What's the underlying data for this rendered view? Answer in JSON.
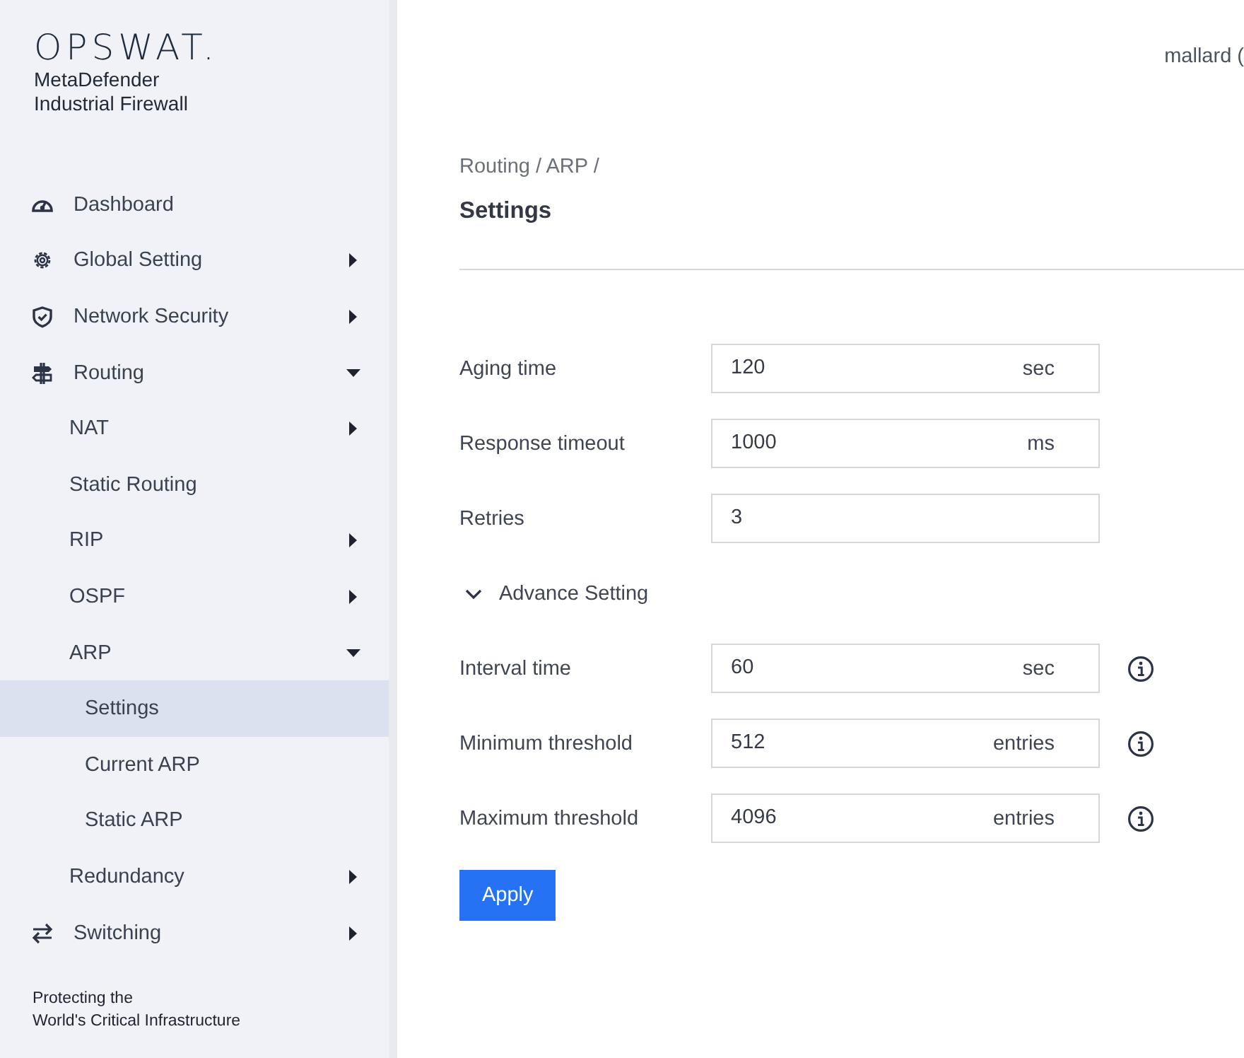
{
  "sidebar": {
    "logo": "OPSWAT.",
    "product_lines": [
      "MetaDefender",
      "Industrial Firewall"
    ],
    "nav": [
      {
        "label": "Dashboard",
        "kind": "dashboard",
        "expandable": false,
        "expanded": false,
        "selected": false
      },
      {
        "label": "Global Setting",
        "kind": "gear",
        "expandable": true,
        "expanded": false,
        "selected": false
      },
      {
        "label": "Network Security",
        "kind": "shield",
        "expandable": true,
        "expanded": false,
        "selected": false
      },
      {
        "label": "Routing",
        "kind": "signpost",
        "expandable": true,
        "expanded": true,
        "selected": false,
        "children": [
          {
            "label": "NAT",
            "expandable": true,
            "expanded": false,
            "selected": false
          },
          {
            "label": "Static Routing",
            "expandable": false,
            "expanded": false,
            "selected": false
          },
          {
            "label": "RIP",
            "expandable": true,
            "expanded": false,
            "selected": false
          },
          {
            "label": "OSPF",
            "expandable": true,
            "expanded": false,
            "selected": false
          },
          {
            "label": "ARP",
            "expandable": true,
            "expanded": true,
            "selected": false,
            "children": [
              {
                "label": "Settings",
                "expandable": false,
                "expanded": false,
                "selected": true
              },
              {
                "label": "Current ARP",
                "expandable": false,
                "expanded": false,
                "selected": false
              },
              {
                "label": "Static ARP",
                "expandable": false,
                "expanded": false,
                "selected": false
              }
            ]
          },
          {
            "label": "Redundancy",
            "expandable": true,
            "expanded": false,
            "selected": false
          }
        ]
      },
      {
        "label": "Switching",
        "kind": "arrows",
        "expandable": true,
        "expanded": false,
        "selected": false
      }
    ],
    "footer_lines": [
      "Protecting the",
      "World's Critical Infrastructure"
    ]
  },
  "header": {
    "user": "mallard ("
  },
  "breadcrumb": "Routing / ARP /",
  "page_title": "Settings",
  "fields": [
    {
      "label": "Aging time",
      "value": "120",
      "unit": "sec",
      "info": false
    },
    {
      "label": "Response timeout",
      "value": "1000",
      "unit": "ms",
      "info": false
    },
    {
      "label": "Retries",
      "value": "3",
      "info": false
    }
  ],
  "advance": {
    "label": "Advance Setting",
    "expanded": true,
    "fields": [
      {
        "label": "Interval time",
        "value": "60",
        "unit": "sec",
        "info": true
      },
      {
        "label": "Minimum threshold",
        "value": "512",
        "unit": "entries",
        "info": true
      },
      {
        "label": "Maximum threshold",
        "value": "4096",
        "unit": "entries",
        "info": true
      }
    ]
  },
  "apply_button": "Apply"
}
